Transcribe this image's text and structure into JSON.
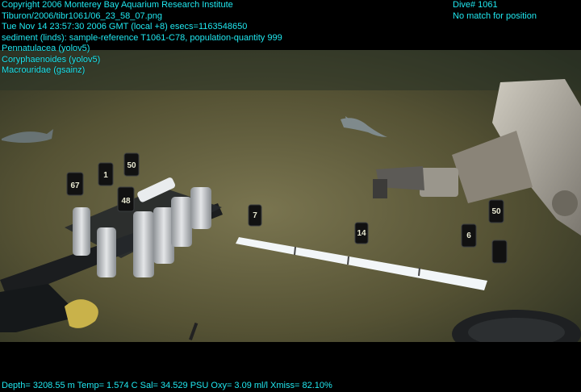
{
  "overlay": {
    "header_lines": [
      "Copyright 2006 Monterey Bay Aquarium Research Institute",
      "Tiburon/2006/tibr1061/06_23_58_07.png",
      "Tue Nov 14 23:57:30 2006 GMT (local +8)  esecs=1163548650",
      "sediment (linds): sample-reference T1061-C78, population-quantity 999",
      "Pennatulacea (yolov5)",
      "Coryphaenoides (yolov5)",
      "Macrouridae (gsainz)"
    ],
    "dive_label": "Dive# 1061",
    "position_status": "No match for position",
    "telemetry": "Depth= 3208.55 m  Temp= 1.574 C  Sal= 34.529 PSU  Oxy= 3.09 ml/l  Xmiss= 82.10%"
  },
  "scene": {
    "tube_labels": [
      "67",
      "1",
      "50",
      "48",
      "7",
      "14",
      "50",
      "6"
    ],
    "colors": {
      "text": "#20e8f0",
      "seafloor": "#5e5a3c",
      "water": "#1d2a22"
    }
  }
}
